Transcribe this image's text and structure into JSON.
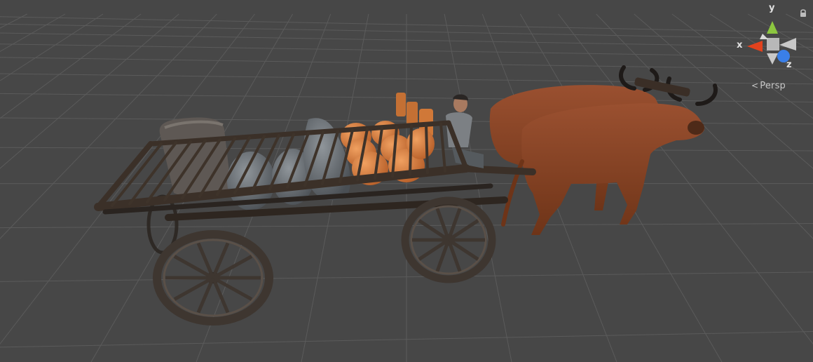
{
  "view": {
    "projection_label": "Persp",
    "background_color": "#474747",
    "grid_color": "#5b5b5b"
  },
  "gizmo": {
    "axes": {
      "y": {
        "label": "y",
        "color": "#8cc63f"
      },
      "x": {
        "label": "x",
        "color": "#e2421d"
      },
      "z": {
        "label": "z",
        "color": "#3a7fe8"
      }
    }
  },
  "icons": {
    "lock": "lock-icon",
    "persp_chevron": "chevron-left-icon"
  }
}
